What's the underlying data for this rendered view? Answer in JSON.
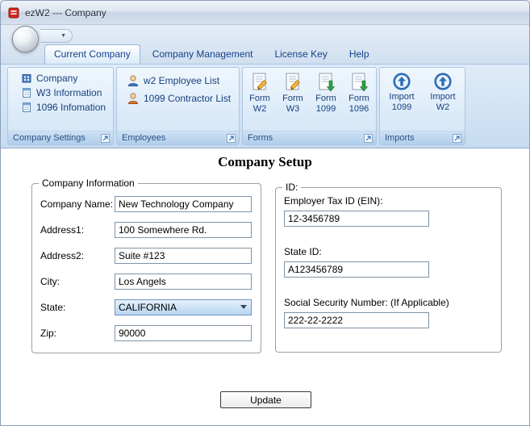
{
  "window": {
    "title": "ezW2 --- Company"
  },
  "icons": {
    "dropdown_arrow": "▼"
  },
  "tabs": [
    {
      "label": "Current Company"
    },
    {
      "label": "Company Management"
    },
    {
      "label": "License Key"
    },
    {
      "label": "Help"
    }
  ],
  "ribbon": {
    "groups": [
      {
        "title": "Company Settings",
        "items": [
          {
            "label": "Company"
          },
          {
            "label": "W3 Information"
          },
          {
            "label": "1096 Infomation"
          }
        ]
      },
      {
        "title": "Employees",
        "items": [
          {
            "label": "w2 Employee List"
          },
          {
            "label": "1099 Contractor List"
          }
        ]
      },
      {
        "title": "Forms",
        "items": [
          {
            "line1": "Form",
            "line2": "W2"
          },
          {
            "line1": "Form",
            "line2": "W3"
          },
          {
            "line1": "Form",
            "line2": "1099"
          },
          {
            "line1": "Form",
            "line2": "1096"
          }
        ]
      },
      {
        "title": "Imports",
        "items": [
          {
            "line1": "Import",
            "line2": "1099"
          },
          {
            "line1": "Import",
            "line2": "W2"
          }
        ]
      }
    ]
  },
  "main": {
    "heading": "Company Setup",
    "company_info": {
      "legend": "Company Information",
      "fields": [
        {
          "label": "Company Name:",
          "value": "New Technology Company"
        },
        {
          "label": "Address1:",
          "value": "100 Somewhere Rd."
        },
        {
          "label": "Address2:",
          "value": "Suite #123"
        },
        {
          "label": "City:",
          "value": "Los Angels"
        },
        {
          "label": "State:",
          "value": "CALIFORNIA"
        },
        {
          "label": "Zip:",
          "value": "90000"
        }
      ]
    },
    "ids": {
      "legend": "ID:",
      "fields": [
        {
          "label": "Employer Tax ID (EIN):",
          "value": "12-3456789"
        },
        {
          "label": "State ID:",
          "value": "A123456789"
        },
        {
          "label": "Social Security Number: (If Applicable)",
          "value": "222-22-2222"
        }
      ]
    },
    "update_button": "Update"
  }
}
